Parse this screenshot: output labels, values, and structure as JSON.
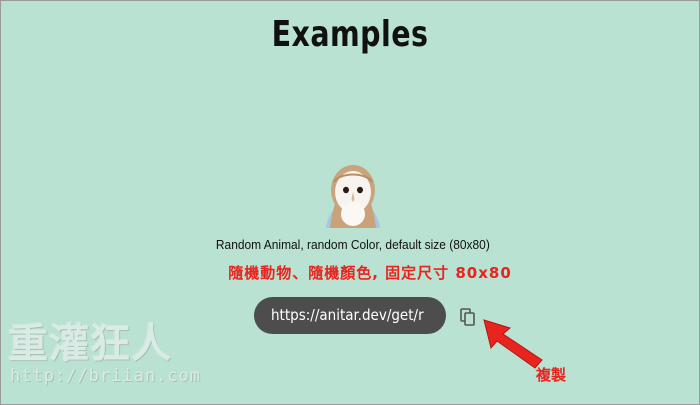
{
  "page": {
    "title": "Examples"
  },
  "example": {
    "avatar_icon": "barn-owl-avatar",
    "caption": "Random Animal, random Color, default size (80x80)",
    "url": "https://anitar.dev/get/r",
    "copy_icon": "copy-icon"
  },
  "annotations": {
    "caption_translation": "隨機動物、隨機顏色, 固定尺寸  80x80",
    "copy_label": "複製",
    "color": "#e8241f"
  },
  "watermark": {
    "brand": "重灌狂人",
    "url": "http://briian.com"
  },
  "colors": {
    "background": "#b9e2d2",
    "pill": "#4d4d4d"
  }
}
